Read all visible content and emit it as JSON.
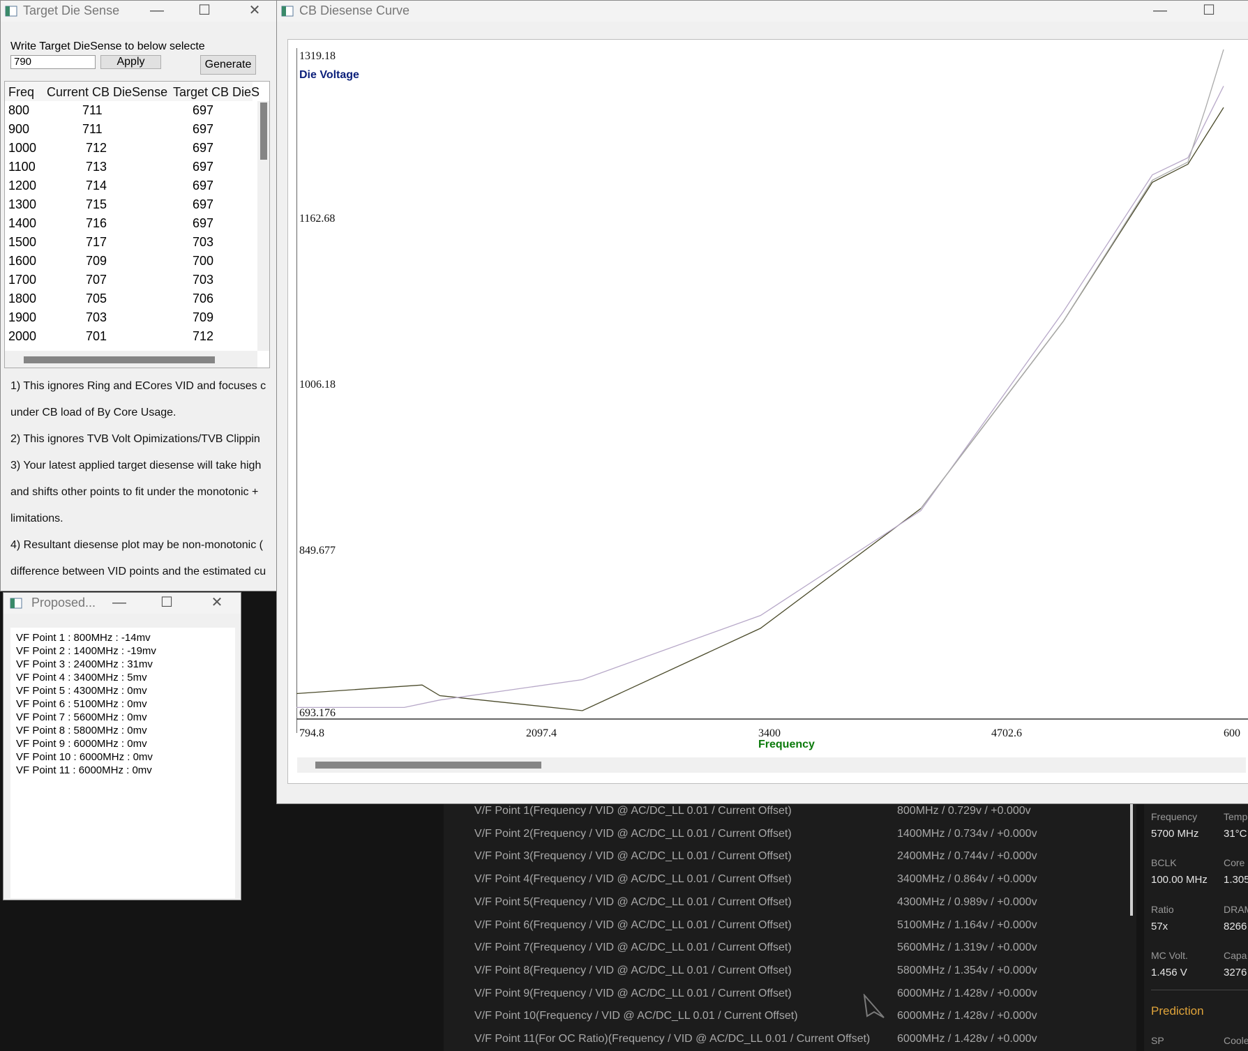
{
  "target_window": {
    "title": "Target Die Sense",
    "instruction": "Write Target DieSense to below selecte",
    "target_value": "790",
    "apply_label": "Apply",
    "generate_label": "Generate",
    "columns": [
      "Freq",
      "Current CB DieSense",
      "Target CB DieS"
    ],
    "rows": [
      [
        "800",
        "711",
        "697"
      ],
      [
        "900",
        "711",
        "697"
      ],
      [
        "1000",
        "712",
        "697"
      ],
      [
        "1100",
        "713",
        "697"
      ],
      [
        "1200",
        "714",
        "697"
      ],
      [
        "1300",
        "715",
        "697"
      ],
      [
        "1400",
        "716",
        "697"
      ],
      [
        "1500",
        "717",
        "703"
      ],
      [
        "1600",
        "709",
        "700"
      ],
      [
        "1700",
        "707",
        "703"
      ],
      [
        "1800",
        "705",
        "706"
      ],
      [
        "1900",
        "703",
        "709"
      ],
      [
        "2000",
        "701",
        "712"
      ]
    ],
    "notes": [
      "1) This ignores Ring and ECores VID and focuses c",
      "under CB load of By Core Usage.",
      "2) This ignores TVB Volt Opimizations/TVB Clippin",
      "3) Your latest applied target diesense will take high",
      "and shifts other points to fit under the monotonic +",
      "limitations.",
      "4) Resultant diesense plot may be non-monotonic (",
      "difference between VID points and the estimated cu"
    ]
  },
  "proposed_window": {
    "title": "Proposed...",
    "lines": [
      "VF Point 1 : 800MHz : -14mv",
      "VF Point 2 : 1400MHz : -19mv",
      "VF Point 3 : 2400MHz : 31mv",
      "VF Point 4 : 3400MHz : 5mv",
      "VF Point 5 : 4300MHz : 0mv",
      "VF Point 6 : 5100MHz : 0mv",
      "VF Point 7 : 5600MHz : 0mv",
      "VF Point 8 : 5800MHz : 0mv",
      "VF Point 9 : 6000MHz : 0mv",
      "VF Point 10 : 6000MHz : 0mv",
      "VF Point 11 : 6000MHz : 0mv"
    ]
  },
  "chart_window": {
    "title": "CB Diesense Curve"
  },
  "chart_data": {
    "type": "line",
    "ylabel": "Die Voltage",
    "xlabel": "Frequency",
    "y_ticks": [
      "1319.18",
      "1162.68",
      "1006.18",
      "849.677",
      "693.176"
    ],
    "x_ticks": [
      "794.8",
      "2097.4",
      "3400",
      "4702.6",
      "600"
    ],
    "xlim": [
      794.8,
      6000
    ],
    "ylim": [
      693.176,
      1319.18
    ],
    "series": [
      {
        "color": "#4a4a2a",
        "x": [
          794.8,
          1500,
          1600,
          2400,
          3400,
          4300,
          5100,
          5600,
          5800,
          6000
        ],
        "y": [
          717,
          725,
          715,
          701,
          778,
          890,
          1065,
          1195,
          1212,
          1265
        ]
      },
      {
        "color": "#b7a8c8",
        "x": [
          794.8,
          1400,
          1600,
          2400,
          3400,
          4300,
          5100,
          5600,
          5800,
          6000
        ],
        "y": [
          704,
          704,
          711,
          730,
          790,
          888,
          1074,
          1202,
          1218,
          1285
        ]
      },
      {
        "color": "#aaaaaa",
        "x": [
          4300,
          5100,
          5600,
          5800,
          5900,
          6000
        ],
        "y": [
          890,
          1065,
          1197,
          1214,
          1265,
          1319.18
        ]
      }
    ]
  },
  "vf_table": {
    "labels": [
      "V/F Point 1(Frequency / VID @ AC/DC_LL 0.01 / Current Offset)",
      "V/F Point 2(Frequency / VID @ AC/DC_LL 0.01 / Current Offset)",
      "V/F Point 3(Frequency / VID @ AC/DC_LL 0.01 / Current Offset)",
      "V/F Point 4(Frequency / VID @ AC/DC_LL 0.01 / Current Offset)",
      "V/F Point 5(Frequency / VID @ AC/DC_LL 0.01 / Current Offset)",
      "V/F Point 6(Frequency / VID @ AC/DC_LL 0.01 / Current Offset)",
      "V/F Point 7(Frequency / VID @ AC/DC_LL 0.01 / Current Offset)",
      "V/F Point 8(Frequency / VID @ AC/DC_LL 0.01 / Current Offset)",
      "V/F Point 9(Frequency / VID @ AC/DC_LL 0.01 / Current Offset)",
      "V/F Point 10(Frequency / VID @ AC/DC_LL 0.01 / Current Offset)",
      "V/F Point 11(For OC Ratio)(Frequency / VID @ AC/DC_LL 0.01 / Current Offset)"
    ],
    "values": [
      "800MHz / 0.729v / +0.000v",
      "1400MHz / 0.734v / +0.000v",
      "2400MHz / 0.744v / +0.000v",
      "3400MHz / 0.864v / +0.000v",
      "4300MHz / 0.989v / +0.000v",
      "5100MHz / 1.164v / +0.000v",
      "5600MHz / 1.319v / +0.000v",
      "5800MHz / 1.354v / +0.000v",
      "6000MHz / 1.428v / +0.000v",
      "6000MHz / 1.428v / +0.000v",
      "6000MHz / 1.428v / +0.000v"
    ]
  },
  "monitor_panel": {
    "frequency_label": "Frequency",
    "frequency_value": "5700 MHz",
    "temp_label": "Temp",
    "temp_value": "31°C",
    "bclk_label": "BCLK",
    "bclk_value": "100.00 MHz",
    "corev_label": "Core",
    "corev_value": "1.305",
    "ratio_label": "Ratio",
    "ratio_value": "57x",
    "dram_label": "DRAM",
    "dram_value": "8266",
    "mcvolt_label": "MC Volt.",
    "mcvolt_value": "1.456 V",
    "capa_label": "Capa",
    "capa_value": "3276",
    "prediction_label": "Prediction",
    "sp_label": "SP",
    "coolant_label": "Coole"
  },
  "colors": {
    "ylabel": "#0b1f7a",
    "xlabel": "#0b7a0b",
    "accent": "#e0a43a"
  }
}
